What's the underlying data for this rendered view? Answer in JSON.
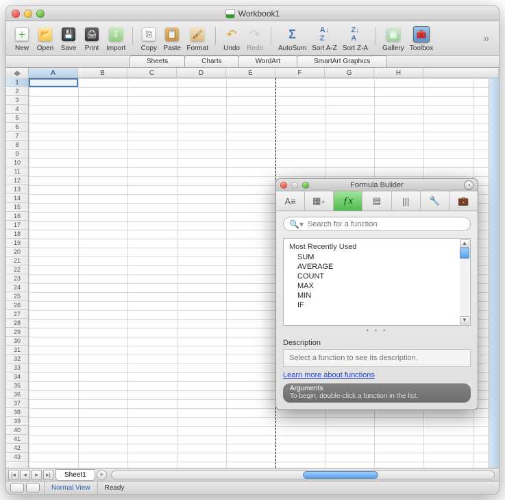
{
  "window": {
    "title": "Workbook1"
  },
  "toolbar": {
    "items": [
      {
        "id": "new",
        "label": "New"
      },
      {
        "id": "open",
        "label": "Open"
      },
      {
        "id": "save",
        "label": "Save"
      },
      {
        "id": "print",
        "label": "Print"
      },
      {
        "id": "import",
        "label": "Import"
      },
      {
        "id": "copy",
        "label": "Copy"
      },
      {
        "id": "paste",
        "label": "Paste"
      },
      {
        "id": "format",
        "label": "Format"
      },
      {
        "id": "undo",
        "label": "Undo"
      },
      {
        "id": "redo",
        "label": "Redo",
        "disabled": true
      },
      {
        "id": "autosum",
        "label": "AutoSum"
      },
      {
        "id": "sortaz",
        "label": "Sort A-Z"
      },
      {
        "id": "sortza",
        "label": "Sort Z-A"
      },
      {
        "id": "gallery",
        "label": "Gallery"
      },
      {
        "id": "toolbox",
        "label": "Toolbox"
      }
    ]
  },
  "ribbon": {
    "tabs": [
      "Sheets",
      "Charts",
      "WordArt",
      "SmartArt Graphics"
    ]
  },
  "grid": {
    "columns": [
      "A",
      "B",
      "C",
      "D",
      "E",
      "F",
      "G",
      "H"
    ],
    "row_count": 43,
    "active_cell": "A1",
    "selected_col": "A",
    "selected_row": 1,
    "resize_col_edge_after": "E"
  },
  "sheet_tabs": {
    "tabs": [
      "Sheet1"
    ],
    "active": "Sheet1"
  },
  "statusbar": {
    "view_label": "Normal View",
    "status": "Ready"
  },
  "formula_builder": {
    "title": "Formula Builder",
    "search_placeholder": "Search for a function",
    "category": "Most Recently Used",
    "functions": [
      "SUM",
      "AVERAGE",
      "COUNT",
      "MAX",
      "MIN",
      "IF"
    ],
    "description_title": "Description",
    "description_text": "Select a function to see its description.",
    "learn_more": "Learn more about functions",
    "arguments_title": "Arguments",
    "arguments_text": "To begin, double-click a function in the list."
  }
}
